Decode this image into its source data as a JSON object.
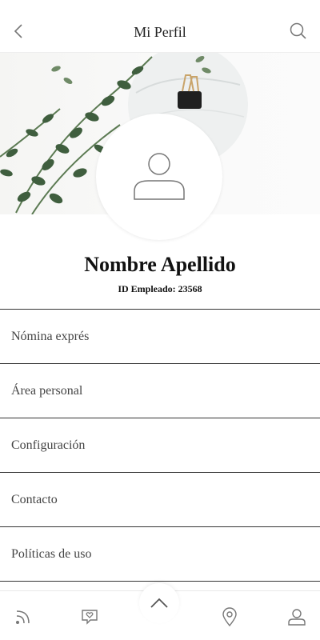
{
  "header": {
    "title": "Mi Perfil",
    "back_icon": "chevron-left-icon",
    "search_icon": "search-icon"
  },
  "profile": {
    "name": "Nombre Apellido",
    "employee_id": "ID Empleado: 23568",
    "avatar_icon": "user-icon"
  },
  "menu": {
    "items": [
      {
        "label": "Nómina exprés"
      },
      {
        "label": "Área personal"
      },
      {
        "label": "Configuración"
      },
      {
        "label": "Contacto"
      },
      {
        "label": "Políticas de uso"
      }
    ]
  },
  "tabbar": {
    "tabs": [
      {
        "icon": "feed-icon"
      },
      {
        "icon": "chat-heart-icon"
      },
      {
        "icon": "chevron-up-icon"
      },
      {
        "icon": "location-pin-icon"
      },
      {
        "icon": "user-icon"
      }
    ]
  },
  "colors": {
    "text": "#222222",
    "divider": "#333333",
    "background": "#ffffff"
  }
}
